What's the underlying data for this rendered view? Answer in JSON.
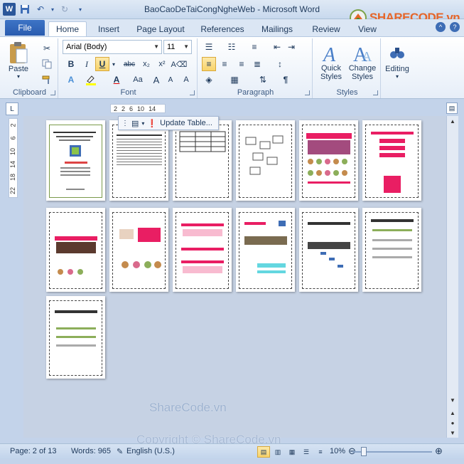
{
  "window": {
    "title": "BaoCaoDeTaiCongNgheWeb  -  Microsoft Word",
    "app_icon": "W"
  },
  "watermark_logo": "SHARECODE.vn",
  "tabs": {
    "file": "File",
    "items": [
      "Home",
      "Insert",
      "Page Layout",
      "References",
      "Mailings",
      "Review",
      "View"
    ],
    "active": "Home"
  },
  "ribbon": {
    "clipboard": {
      "label": "Clipboard",
      "paste": "Paste"
    },
    "font": {
      "label": "Font",
      "font_name": "Arial (Body)",
      "font_size": "11"
    },
    "paragraph": {
      "label": "Paragraph"
    },
    "styles": {
      "label": "Styles",
      "quick_styles": "Quick\nStyles",
      "change_styles": "Change\nStyles"
    },
    "editing": {
      "label": "Editing"
    }
  },
  "ruler": {
    "h_ticks": [
      "2",
      "2",
      "6",
      "10",
      "14"
    ],
    "v_ticks": [
      "2",
      "6",
      "10",
      "14",
      "18",
      "22"
    ]
  },
  "popup": {
    "label": "Update Table..."
  },
  "watermarks": {
    "center": "ShareCode.vn",
    "bottom": "Copyright © ShareCode.vn"
  },
  "status": {
    "page": "Page: 2 of 13",
    "words": "Words: 965",
    "language": "English (U.S.)",
    "zoom": "10%"
  }
}
